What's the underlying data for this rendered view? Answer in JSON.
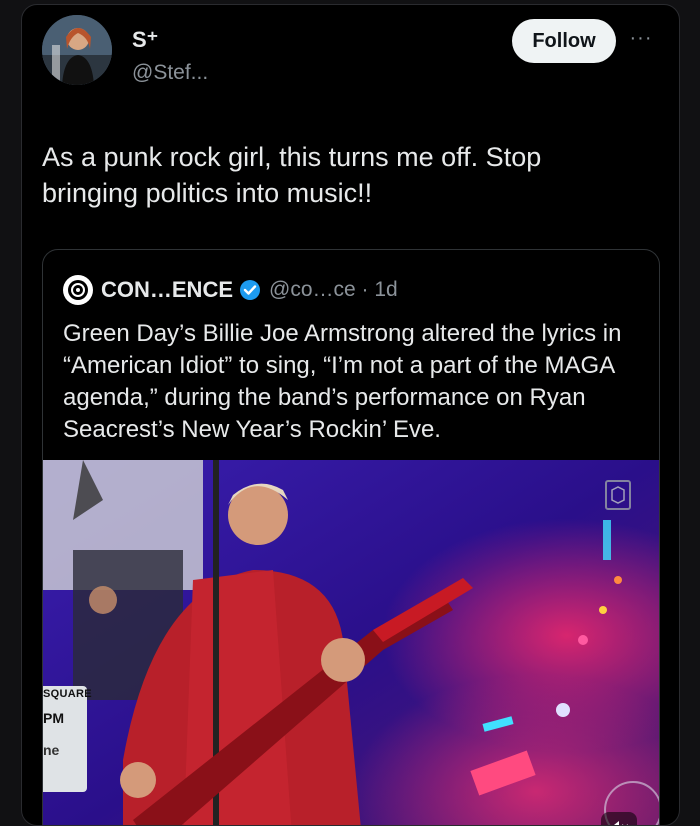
{
  "post": {
    "author_name": "S⁺",
    "author_handle": "@Stef...",
    "follow_label": "Follow",
    "more_label": "···",
    "text": "As a punk rock girl, this turns me off. Stop bringing politics into music!!"
  },
  "quote": {
    "name": "CON…ENCE",
    "handle": "@co…ce · 1d",
    "text": "Green Day’s Billie Joe Armstrong altered the lyrics in “American Idiot” to sing, “I’m not a part of the MAGA agenda,” during the band’s performance on Ryan Seacrest’s New Year’s Rockin’ Eve.",
    "media": {
      "lower_third_line1": "SQUARE",
      "lower_third_line2": "PM",
      "lower_third_line3": "ne",
      "mute_label": "🔇"
    }
  },
  "colors": {
    "background": "#000000",
    "text": "#e7e9ea",
    "secondary": "#8b9299",
    "verified": "#1d9bf0",
    "follow_bg": "#eff3f4"
  }
}
